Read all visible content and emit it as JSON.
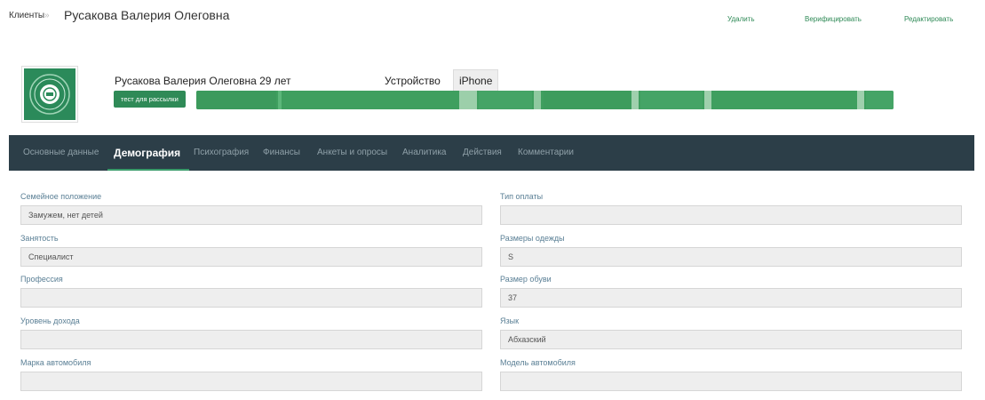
{
  "breadcrumb": {
    "root": "Клиенты",
    "separator": "»"
  },
  "page_title": "Русакова Валерия Олеговна",
  "actions": {
    "delete": "Удалить",
    "verify": "Верифицировать",
    "edit": "Редактировать"
  },
  "profile": {
    "name_age": "Русакова Валерия Олеговна 29 лет",
    "device_label": "Устройство",
    "device_value": "iPhone",
    "tag_chip": "тест для рассылки"
  },
  "tabs": [
    {
      "label": "Основные данные",
      "active": false
    },
    {
      "label": "Демография",
      "active": true
    },
    {
      "label": "Психография",
      "active": false
    },
    {
      "label": "Финансы",
      "active": false
    },
    {
      "label": "Анкеты и опросы",
      "active": false
    },
    {
      "label": "Аналитика",
      "active": false
    },
    {
      "label": "Действия",
      "active": false
    },
    {
      "label": "Комментарии",
      "active": false
    }
  ],
  "fields": {
    "marital_status": {
      "label": "Семейное положение",
      "value": "Замужем, нет детей"
    },
    "employment": {
      "label": "Занятость",
      "value": "Специалист"
    },
    "profession": {
      "label": "Профессия",
      "value": ""
    },
    "income_level": {
      "label": "Уровень дохода",
      "value": ""
    },
    "car_brand": {
      "label": "Марка автомобиля",
      "value": ""
    },
    "payment_type": {
      "label": "Тип оплаты",
      "value": ""
    },
    "clothing_size": {
      "label": "Размеры одежды",
      "value": "S"
    },
    "shoe_size": {
      "label": "Размер обуви",
      "value": "37"
    },
    "language": {
      "label": "Язык",
      "value": "Абхазский"
    },
    "car_model": {
      "label": "Модель автомобиля",
      "value": ""
    }
  },
  "colors": {
    "accent": "#2f8a57",
    "tabbar": "#2c3e48",
    "label": "#5a7f95",
    "field_bg": "#eeeeee"
  }
}
